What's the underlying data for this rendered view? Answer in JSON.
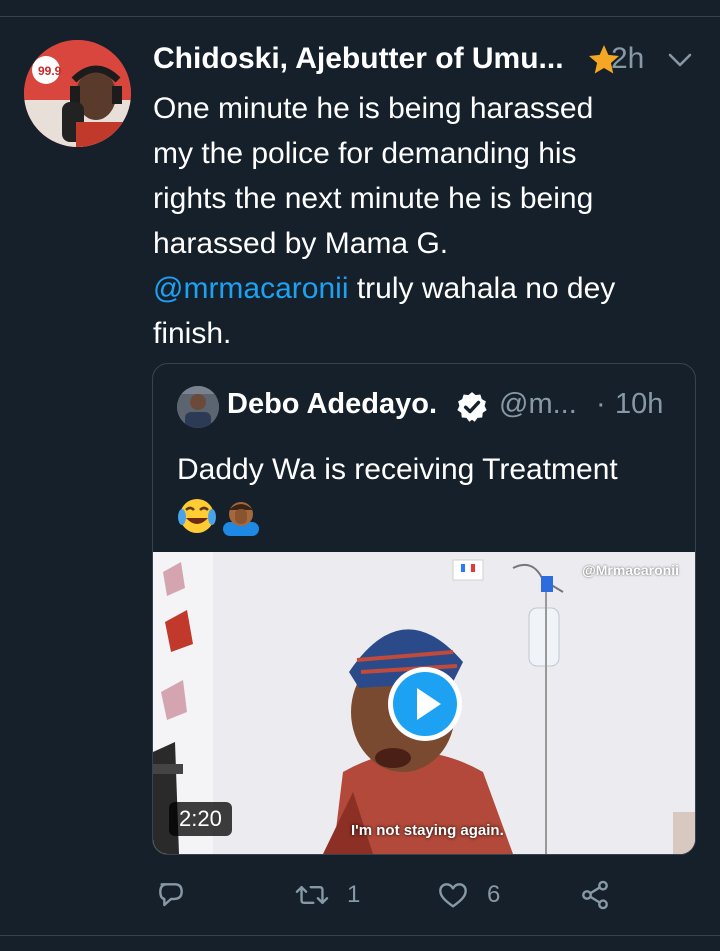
{
  "tweet": {
    "author_name": "Chidoski, Ajebutter of Umu...",
    "time": "2h",
    "text_lines": [
      "One minute he is being harassed",
      "my the police for demanding his",
      "rights the next minute he is being",
      "harassed by Mama G."
    ],
    "mention": "@mrmacaronii",
    "text_after_mention": " truly wahala no dey",
    "text_last_line": "finish.",
    "icons": {
      "star": "star-icon",
      "menu": "chevron-down-icon"
    }
  },
  "quote": {
    "name": "Debo Adedayo.",
    "handle": "@m...",
    "separator": "·",
    "time": "10h",
    "text": "Daddy Wa is receiving Treatment",
    "emojis": [
      "face-with-tears-of-joy",
      "person-facepalming"
    ],
    "media": {
      "watermark": "@Mrmacaronii",
      "subtitle": "I'm not staying again.",
      "duration": "2:20"
    }
  },
  "actions": {
    "reply_count": "",
    "retweet_count": "1",
    "like_count": "6",
    "icons": [
      "reply-icon",
      "retweet-icon",
      "like-icon",
      "share-icon"
    ]
  },
  "colors": {
    "background": "#15202b",
    "accent": "#1da1f2",
    "muted": "#8899a6",
    "divider": "#38444d",
    "star": "#f5a623"
  }
}
